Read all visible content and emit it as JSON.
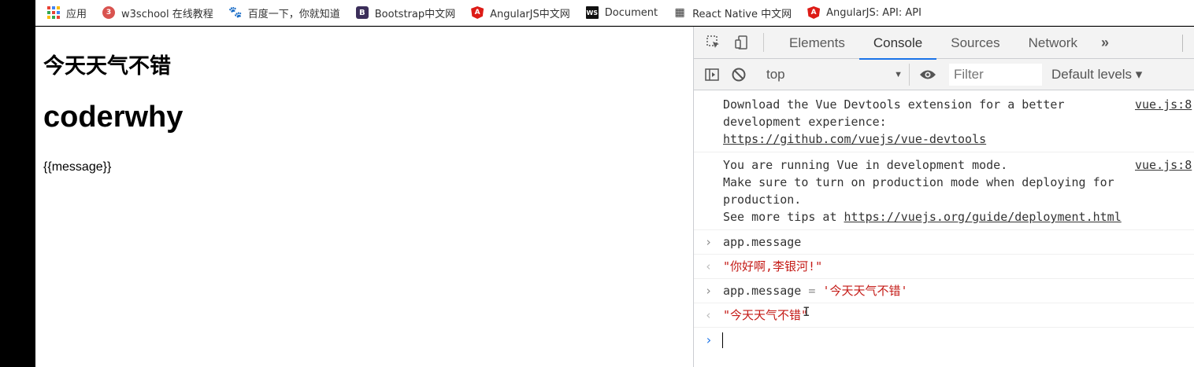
{
  "bookmarks": [
    {
      "label": "应用",
      "icon": "apps-grid-icon"
    },
    {
      "label": "w3school 在线教程",
      "icon": "w3school-icon"
    },
    {
      "label": "百度一下，你就知道",
      "icon": "baidu-paw-icon"
    },
    {
      "label": "Bootstrap中文网",
      "icon": "bootstrap-icon"
    },
    {
      "label": "AngularJS中文网",
      "icon": "angular-icon"
    },
    {
      "label": "Document",
      "icon": "webstorm-icon"
    },
    {
      "label": "React Native 中文网",
      "icon": "react-native-icon"
    },
    {
      "label": "AngularJS: API: API",
      "icon": "angular-icon"
    }
  ],
  "icon_glyphs": {
    "w3": "3",
    "bs": "B",
    "ng": "A",
    "ws": "WS",
    "baidu": "🐾",
    "rn": "▦"
  },
  "page": {
    "h2": "今天天气不错",
    "h1": "coderwhy",
    "message": "{{message}}"
  },
  "devtools": {
    "tabs": [
      "Elements",
      "Console",
      "Sources",
      "Network"
    ],
    "active_tab": "Console",
    "more": "»",
    "context": "top",
    "filter_placeholder": "Filter",
    "levels": "Default levels ▾",
    "accent": "#1a73e8",
    "string_color": "#c41a16"
  },
  "console": {
    "msg1": {
      "line1": "Download the Vue Devtools extension for a better",
      "line2": "development experience:",
      "link": "https://github.com/vuejs/vue-devtools",
      "src": "vue.js:8"
    },
    "msg2": {
      "line1": "You are running Vue in development mode.",
      "line2": "Make sure to turn on production mode when deploying for",
      "line3": "production.",
      "line4_prefix": "See more tips at ",
      "link": "https://vuejs.org/guide/deployment.html",
      "src": "vue.js:8"
    },
    "in1": "app.message",
    "out1": "\"你好啊,李银河!\"",
    "in2_lhs": "app.message",
    "in2_op": " = ",
    "in2_rhs": "'今天天气不错'",
    "out2": "\"今天天气不错\"",
    "chev_in": "›",
    "chev_out": "‹"
  }
}
